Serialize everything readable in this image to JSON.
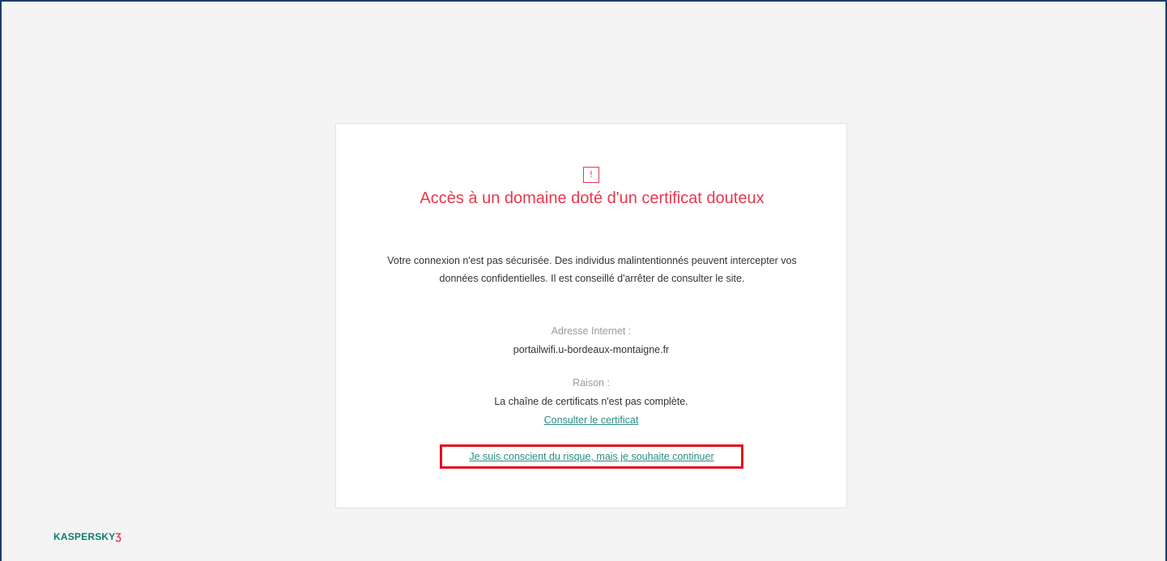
{
  "warning": {
    "icon": "exclamation-icon",
    "icon_glyph": "!",
    "title": "Accès à un domaine doté d'un certificat douteux",
    "description": "Votre connexion n'est pas sécurisée. Des individus malintentionnés peuvent intercepter vos données confidentielles. Il est conseillé d'arrêter de consulter le site."
  },
  "details": {
    "url_label": "Adresse Internet :",
    "url_value": "portailwifi.u-bordeaux-montaigne.fr",
    "reason_label": "Raison :",
    "reason_value": "La chaîne de certificats n'est pas complète."
  },
  "links": {
    "view_certificate": "Consulter le certificat",
    "continue": "Je suis conscient du risque, mais je souhaite continuer"
  },
  "brand": {
    "name": "KASPERSKY",
    "mark": "Ʒ"
  },
  "colors": {
    "accent_red": "#e8384f",
    "link_teal": "#2a8c82",
    "highlight_red": "#e0101e",
    "brand_green": "#0f7c6e"
  }
}
